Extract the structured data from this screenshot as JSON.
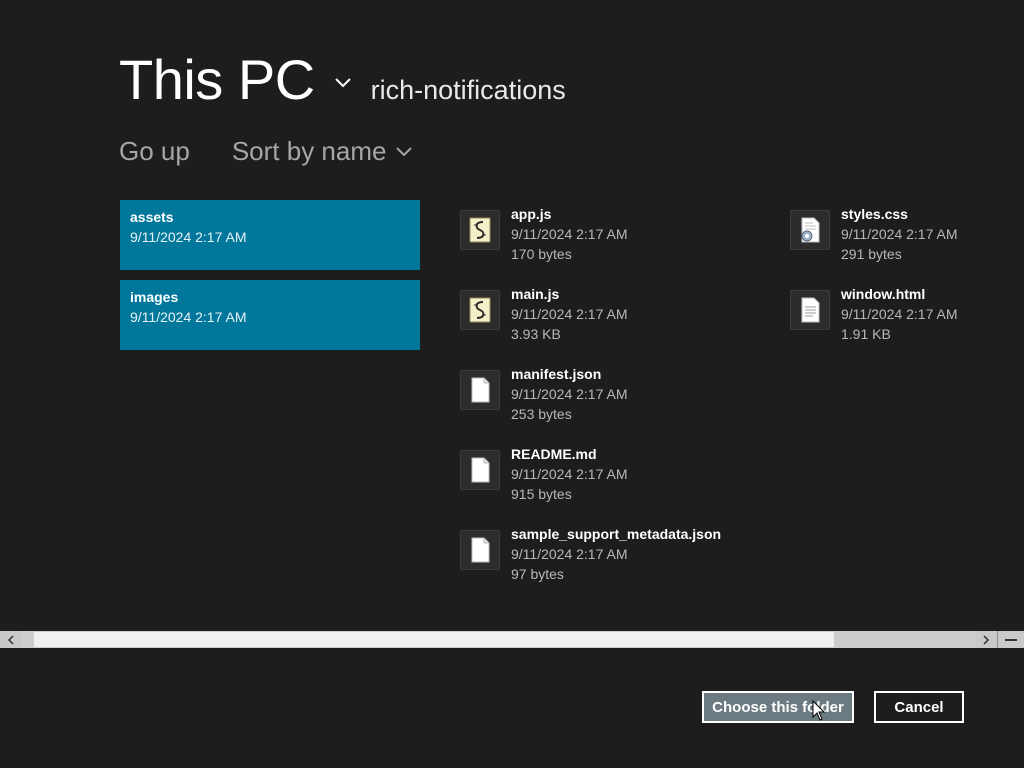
{
  "header": {
    "location": "This PC",
    "folder_name": "rich-notifications"
  },
  "commands": {
    "go_up": "Go up",
    "sort": "Sort by name"
  },
  "folders": [
    {
      "name": "assets",
      "date": "9/11/2024 2:17 AM"
    },
    {
      "name": "images",
      "date": "9/11/2024 2:17 AM"
    }
  ],
  "files": [
    {
      "name": "app.js",
      "date": "9/11/2024 2:17 AM",
      "size": "170 bytes",
      "icon": "script-file-icon"
    },
    {
      "name": "main.js",
      "date": "9/11/2024 2:17 AM",
      "size": "3.93 KB",
      "icon": "script-file-icon"
    },
    {
      "name": "manifest.json",
      "date": "9/11/2024 2:17 AM",
      "size": "253 bytes",
      "icon": "blank-file-icon"
    },
    {
      "name": "README.md",
      "date": "9/11/2024 2:17 AM",
      "size": "915 bytes",
      "icon": "blank-file-icon"
    },
    {
      "name": "sample_support_metadata.json",
      "date": "9/11/2024 2:17 AM",
      "size": "97 bytes",
      "icon": "blank-file-icon"
    },
    {
      "name": "styles.css",
      "date": "9/11/2024 2:17 AM",
      "size": "291 bytes",
      "icon": "settings-file-icon"
    },
    {
      "name": "window.html",
      "date": "9/11/2024 2:17 AM",
      "size": "1.91 KB",
      "icon": "text-file-icon"
    }
  ],
  "buttons": {
    "choose": "Choose this folder",
    "cancel": "Cancel"
  },
  "colors": {
    "background": "#1d1d1d",
    "accent": "#00779b",
    "button_primary": "#6c7b82"
  }
}
